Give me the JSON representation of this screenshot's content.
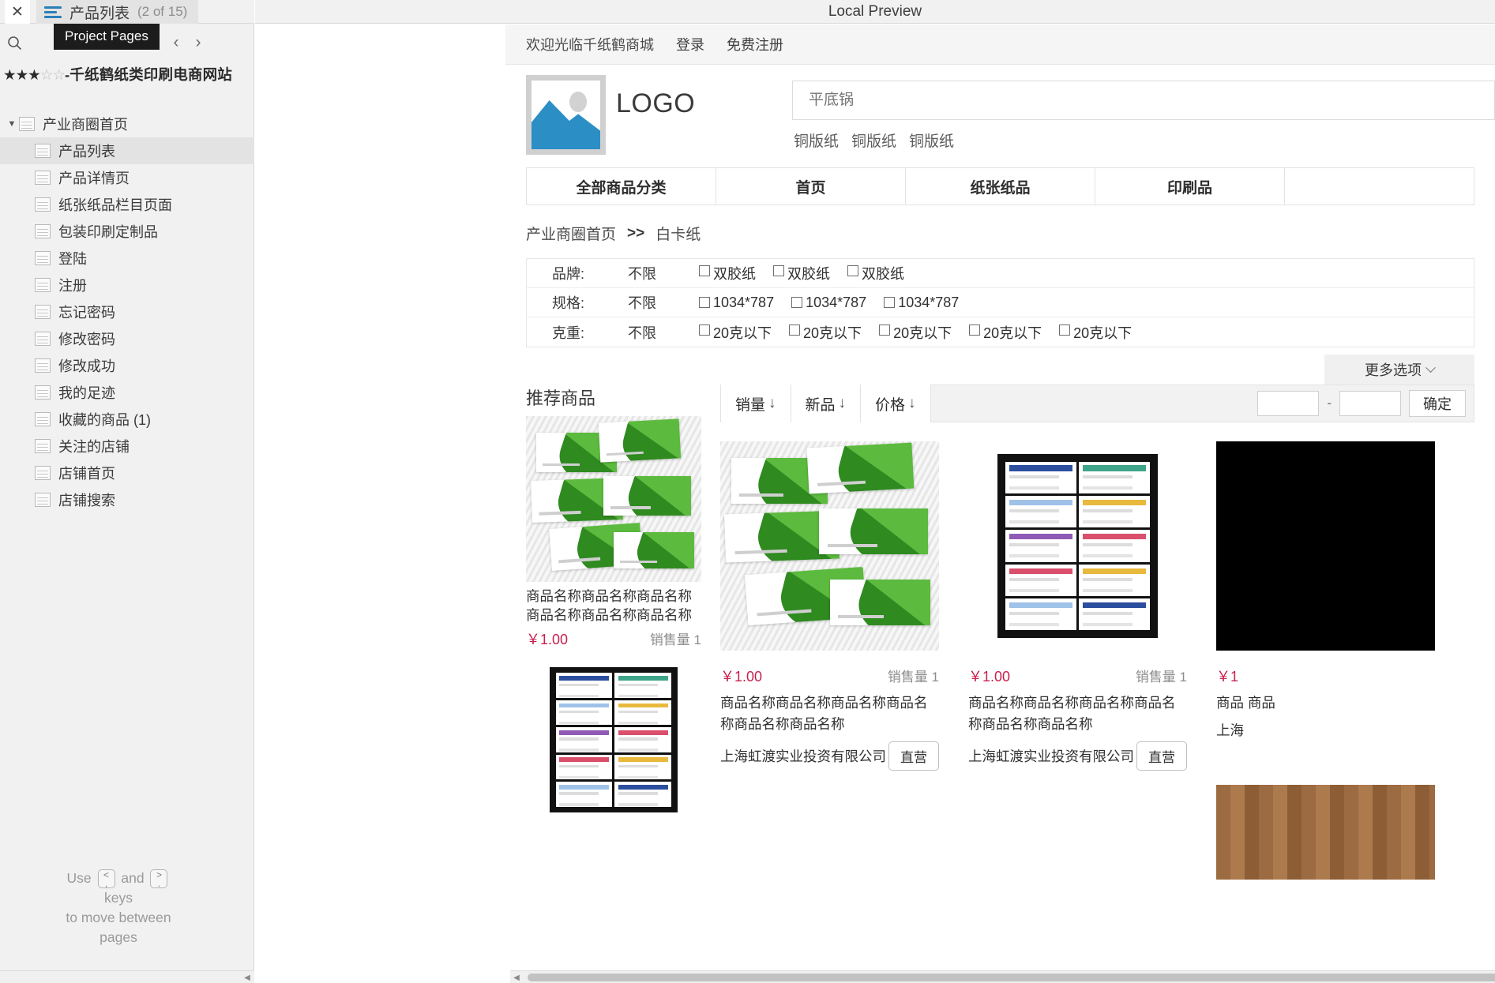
{
  "panel": {
    "close_label": "✕",
    "tab_title": "产品列表",
    "tab_count": "(2 of 15)",
    "tooltip": "Project Pages",
    "search_icon": "search-icon",
    "prev_icon": "‹",
    "next_icon": "›",
    "project_stars_filled": "★★★",
    "project_stars_empty": "☆☆",
    "project_title": "-千纸鹤纸类印刷电商网站",
    "tree": {
      "root_label": "产业商圈首页",
      "caret": "▼",
      "children": [
        {
          "label": "产品列表",
          "selected": true
        },
        {
          "label": "产品详情页",
          "selected": false
        },
        {
          "label": "纸张纸品栏目页面",
          "selected": false
        },
        {
          "label": "包装印刷定制品",
          "selected": false
        },
        {
          "label": "登陆",
          "selected": false
        },
        {
          "label": "注册",
          "selected": false
        },
        {
          "label": "忘记密码",
          "selected": false
        },
        {
          "label": "修改密码",
          "selected": false
        },
        {
          "label": "修改成功",
          "selected": false
        },
        {
          "label": "我的足迹",
          "selected": false
        },
        {
          "label": "收藏的商品 (1)",
          "selected": false
        },
        {
          "label": "关注的店铺",
          "selected": false
        },
        {
          "label": "店铺首页",
          "selected": false
        },
        {
          "label": "店铺搜索",
          "selected": false
        }
      ]
    },
    "hint": {
      "use": "Use",
      "key_prev_top": "<",
      "key_prev_bottom": ",",
      "and": "and",
      "key_next_top": ">",
      "key_next_bottom": ".",
      "line2": "keys",
      "line3": "to move between",
      "line4": "pages"
    }
  },
  "preview": {
    "title": "Local Preview"
  },
  "site": {
    "topbar": {
      "welcome": "欢迎光临千纸鹤商城",
      "login": "登录",
      "register": "免费注册"
    },
    "brand": {
      "logo_text": "LOGO",
      "logo_icon": "image-placeholder-icon"
    },
    "search": {
      "value": "",
      "placeholder": "平底锅"
    },
    "hot_words": [
      "铜版纸",
      "铜版纸",
      "铜版纸"
    ],
    "nav": [
      "全部商品分类",
      "首页",
      "纸张纸品",
      "印刷品",
      ""
    ],
    "breadcrumb": {
      "home": "产业商圈首页",
      "separator": ">>",
      "current": "白卡纸"
    },
    "filters": [
      {
        "label": "品牌:",
        "any": "不限",
        "options": [
          "双胶纸",
          "双胶纸",
          "双胶纸"
        ]
      },
      {
        "label": "规格:",
        "any": "不限",
        "options": [
          "1034*787",
          "1034*787",
          "1034*787"
        ]
      },
      {
        "label": "克重:",
        "any": "不限",
        "options": [
          "20克以下",
          "20克以下",
          "20克以下",
          "20克以下",
          "20克以下"
        ]
      }
    ],
    "more_options": "更多选项",
    "recommend": {
      "title": "推荐商品",
      "items": [
        {
          "name": "商品名称商品名称商品名称商品名称商品名称商品名称",
          "price": "￥1.00",
          "sales": "销售量 1",
          "art": "cards"
        },
        {
          "name": "",
          "price": "",
          "sales": "",
          "art": "poster"
        }
      ]
    },
    "sortbar": {
      "options": [
        "销量",
        "新品",
        "价格"
      ],
      "arrow": "↓",
      "price_min": "",
      "price_max": "",
      "price_min_placeholder": "",
      "price_max_placeholder": "",
      "dash": "-",
      "confirm": "确定"
    },
    "products": [
      {
        "price": "￥1.00",
        "sales": "销售量 1",
        "name": "商品名称商品名称商品名称商品名称商品名称商品名称",
        "shop": "上海虹渡实业投资有限公司",
        "badge": "直营",
        "art": "cards"
      },
      {
        "price": "￥1.00",
        "sales": "销售量 1",
        "name": "商品名称商品名称商品名称商品名称商品名称商品名称",
        "shop": "上海虹渡实业投资有限公司",
        "badge": "直营",
        "art": "poster"
      },
      {
        "price": "￥1",
        "sales": "",
        "name": "商品\n商品",
        "shop": "上海",
        "badge": "",
        "art": "black"
      }
    ]
  },
  "scrollbar": {
    "left_arrow": "◀",
    "right_arrow": "▶",
    "panel_arrow": "◀"
  },
  "colors": {
    "accent": "#2b8fc6",
    "price": "#c8204e",
    "tooltip_bg": "#1c1c1c",
    "panel_bg": "#f1f1f1"
  }
}
